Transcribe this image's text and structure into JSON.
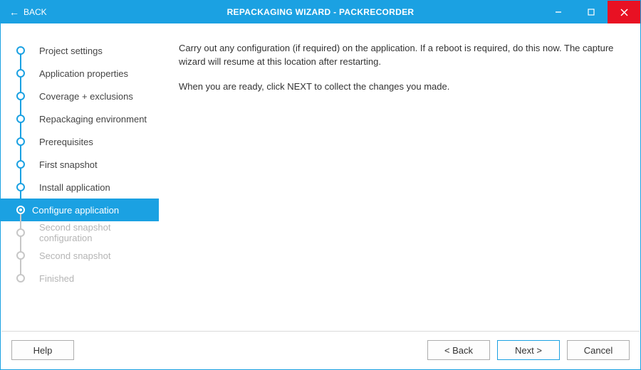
{
  "titlebar": {
    "back_label": "BACK",
    "title": "REPACKAGING WIZARD - PACKRECORDER"
  },
  "sidebar": {
    "steps": [
      {
        "label": "Project settings",
        "state": "done"
      },
      {
        "label": "Application properties",
        "state": "done"
      },
      {
        "label": "Coverage + exclusions",
        "state": "done"
      },
      {
        "label": "Repackaging environment",
        "state": "done"
      },
      {
        "label": "Prerequisites",
        "state": "done"
      },
      {
        "label": "First snapshot",
        "state": "done"
      },
      {
        "label": "Install application",
        "state": "done"
      },
      {
        "label": "Configure application",
        "state": "active"
      },
      {
        "label": "Second snapshot configuration",
        "state": "disabled"
      },
      {
        "label": "Second snapshot",
        "state": "disabled"
      },
      {
        "label": "Finished",
        "state": "disabled"
      }
    ]
  },
  "content": {
    "p1": "Carry out any configuration (if required) on the application. If a reboot is required, do this now. The capture wizard will resume at this location after restarting.",
    "p2": "When you are ready, click NEXT to collect the changes you made."
  },
  "footer": {
    "help_label": "Help",
    "back_label": "< Back",
    "next_label": "Next >",
    "cancel_label": "Cancel"
  }
}
